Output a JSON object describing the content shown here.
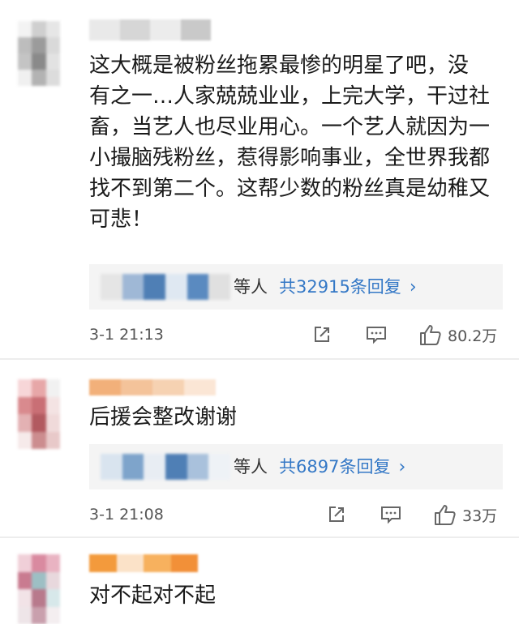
{
  "comments": [
    {
      "text": "这大概是被粉丝拖累最惨的明星了吧，没\n有之一…人家兢兢业业，上完大学，干过社\n畜，当艺人也尽业用心。一个艺人就因为一\n小撮脑残粉丝，惹得影响事业，全世界我都\n找不到第二个。这帮少数的粉丝真是幼稚又\n可悲！",
      "reply_suffix": "等人",
      "reply_count": "共32915条回复",
      "reply_chevron": "›",
      "time": "3-1 21:13",
      "likes": "80.2万",
      "username_colors": [
        "#e9e9e9",
        "#d6d6d6",
        "#ececec",
        "#c9c9c9"
      ],
      "avatar_colors": [
        "#f3f3f3",
        "#cfcfcf",
        "#e6e6e6",
        "#bdbdbd",
        "#9b9b9b",
        "#d9d9d9",
        "#c4c4c4",
        "#8a8a8a",
        "#e2e2e2",
        "#f0f0f0",
        "#b3b3b3",
        "#dcdcdc"
      ],
      "reply_avatar_colors": [
        "#e5e5e5",
        "#9fb8d6",
        "#4f7fb5",
        "#dfe8f2",
        "#5a8ac0",
        "#e0e0e0"
      ]
    },
    {
      "text": "后援会整改谢谢",
      "reply_suffix": "等人",
      "reply_count": "共6897条回复",
      "reply_chevron": "›",
      "time": "3-1 21:08",
      "likes": "33万",
      "username_colors": [
        "#f2b07a",
        "#f4c39a",
        "#f6d2b2",
        "#fbe6d5"
      ],
      "avatar_colors": [
        "#f7d6d8",
        "#e7a7a8",
        "#f1f1f1",
        "#d98a8e",
        "#c96f75",
        "#f4e3e3",
        "#e3b1b3",
        "#b25a60",
        "#f0dada",
        "#f6eaea",
        "#cc8d8f",
        "#e8c9c9"
      ],
      "reply_avatar_colors": [
        "#d9e4ef",
        "#7ea4cb",
        "#e8edf3",
        "#4f7fb5",
        "#a9c1dc",
        "#eef2f6"
      ]
    },
    {
      "text": "对不起对不起",
      "username_colors": [
        "#f39a3c",
        "#fbe2c8",
        "#f7b15e",
        "#f29038"
      ],
      "avatar_colors": [
        "#f0cfd8",
        "#d98aa0",
        "#e9b3c2",
        "#c97b90",
        "#9dbfc4",
        "#e8d8dd",
        "#f2e3e7",
        "#b87a8c",
        "#d7e8ea",
        "#eee5e8",
        "#c9a0ad",
        "#f4eef0"
      ]
    }
  ]
}
